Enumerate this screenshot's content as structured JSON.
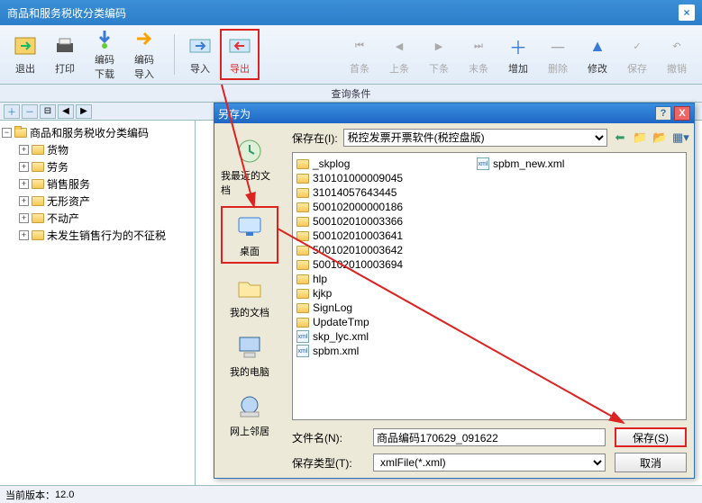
{
  "window": {
    "title": "商品和服务税收分类编码"
  },
  "toolbar": {
    "exit": "退出",
    "print": "打印",
    "bm_down": "编码\n下载",
    "bm_import": "编码\n导入",
    "import": "导入",
    "export": "导出",
    "first": "首条",
    "prev": "上条",
    "next": "下条",
    "last": "末条",
    "add": "增加",
    "del": "删除",
    "edit": "修改",
    "save": "保存",
    "undo": "撤销"
  },
  "midbar": "查询条件",
  "tree": {
    "root": "商品和服务税收分类编码",
    "items": [
      "货物",
      "劳务",
      "销售服务",
      "无形资产",
      "不动产",
      "未发生销售行为的不征税"
    ]
  },
  "dialog": {
    "title": "另存为",
    "save_in_label": "保存在(I):",
    "save_in_value": "税控发票开票软件(税控盘版)",
    "places": {
      "recent": "我最近的文档",
      "desktop": "桌面",
      "mydocs": "我的文档",
      "mypc": "我的电脑",
      "network": "网上邻居"
    },
    "files_folders": [
      "_skplog",
      "310101000009045",
      "31014057643445",
      "500102000000186",
      "500102010003366",
      "500102010003641",
      "500102010003642",
      "500102010003694",
      "hlp",
      "kjkp",
      "SignLog",
      "UpdateTmp"
    ],
    "files_xml": [
      "skp_lyc.xml",
      "spbm.xml",
      "spbm_new.xml"
    ],
    "filename_label": "文件名(N):",
    "filename_value": "商品编码170629_091622",
    "filetype_label": "保存类型(T):",
    "filetype_value": "xmlFile(*.xml)",
    "save_btn": "保存(S)",
    "cancel_btn": "取消"
  },
  "status": {
    "version_label": "当前版本：",
    "version": "12.0"
  }
}
